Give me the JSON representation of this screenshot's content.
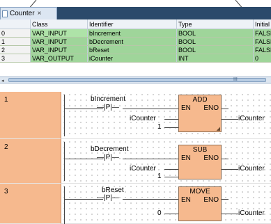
{
  "tab": {
    "label": "Counter",
    "close": "×"
  },
  "table": {
    "headers": [
      "",
      "Class",
      "Identifier",
      "Type",
      "Initial"
    ],
    "rows": [
      {
        "index": "0",
        "class": "VAR_INPUT",
        "identifier": "bIncrement",
        "type": "BOOL",
        "initial": "FALSE"
      },
      {
        "index": "1",
        "class": "VAR_INPUT",
        "identifier": "bDecrement",
        "type": "BOOL",
        "initial": "FALSE"
      },
      {
        "index": "2",
        "class": "VAR_INPUT",
        "identifier": "bReset",
        "type": "BOOL",
        "initial": "FALSE"
      },
      {
        "index": "3",
        "class": "VAR_OUTPUT",
        "identifier": "iCounter",
        "type": "INT",
        "initial": "0"
      }
    ]
  },
  "scrollbar": {
    "left_arrow": "◂",
    "grip": "III"
  },
  "networks": [
    {
      "number": "1",
      "input_var": "bIncrement",
      "contact": "—|P|—",
      "block": "ADD",
      "en": "EN",
      "eno": "ENO",
      "in1": "iCounter",
      "in2": "1",
      "output": "iCounter"
    },
    {
      "number": "2",
      "input_var": "bDecrement",
      "contact": "—|P|—",
      "block": "SUB",
      "en": "EN",
      "eno": "ENO",
      "in1": "iCounter",
      "in2": "1",
      "output": "iCounter"
    },
    {
      "number": "3",
      "input_var": "bReset",
      "contact": "—|P|—",
      "block": "MOVE",
      "en": "EN",
      "eno": "ENO",
      "in1": "0",
      "output": "iCounter"
    }
  ]
}
